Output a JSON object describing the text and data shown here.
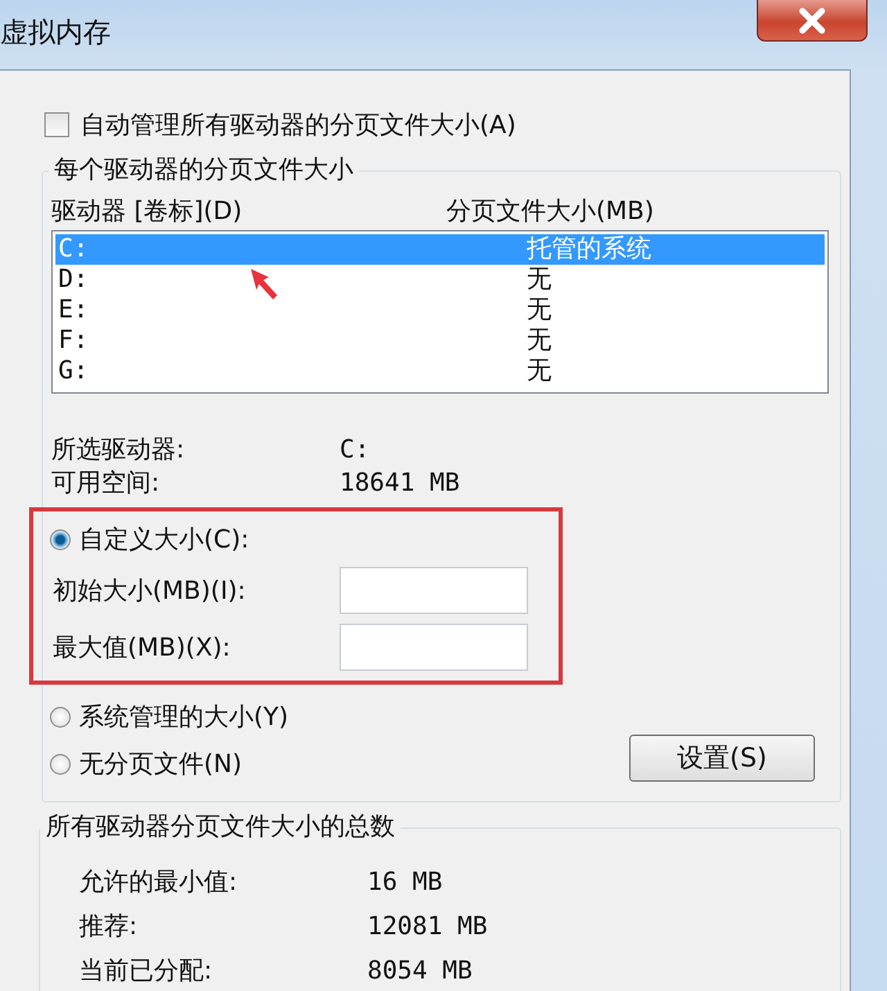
{
  "window": {
    "title": "虚拟内存"
  },
  "auto_manage": {
    "label": "自动管理所有驱动器的分页文件大小(A)",
    "checked": false
  },
  "per_drive": {
    "title": "每个驱动器的分页文件大小",
    "columns": [
      "驱动器 [卷标](D)",
      "分页文件大小(MB)"
    ],
    "drives": [
      {
        "drive": "C:",
        "size": "托管的系统",
        "selected": true
      },
      {
        "drive": "D:",
        "size": "无",
        "selected": false
      },
      {
        "drive": "E:",
        "size": "无",
        "selected": false
      },
      {
        "drive": "F:",
        "size": "无",
        "selected": false
      },
      {
        "drive": "G:",
        "size": "无",
        "selected": false
      }
    ],
    "info": [
      {
        "label": "所选驱动器:",
        "value": "C:"
      },
      {
        "label": "可用空间:",
        "value": "18641 MB"
      }
    ],
    "options": [
      {
        "label": "自定义大小(C):",
        "selected": true
      },
      {
        "label": "系统管理的大小(Y)",
        "selected": false
      },
      {
        "label": "无分页文件(N)",
        "selected": false
      }
    ],
    "fields": [
      {
        "label": "初始大小(MB)(I):"
      },
      {
        "label": "最大值(MB)(X):"
      }
    ],
    "set_button": "设置(S)"
  },
  "totals": {
    "title": "所有驱动器分页文件大小的总数",
    "rows": [
      {
        "label": "允许的最小值:",
        "value": "16 MB"
      },
      {
        "label": "推荐:",
        "value": "12081 MB"
      },
      {
        "label": "当前已分配:",
        "value": "8054 MB"
      }
    ]
  }
}
